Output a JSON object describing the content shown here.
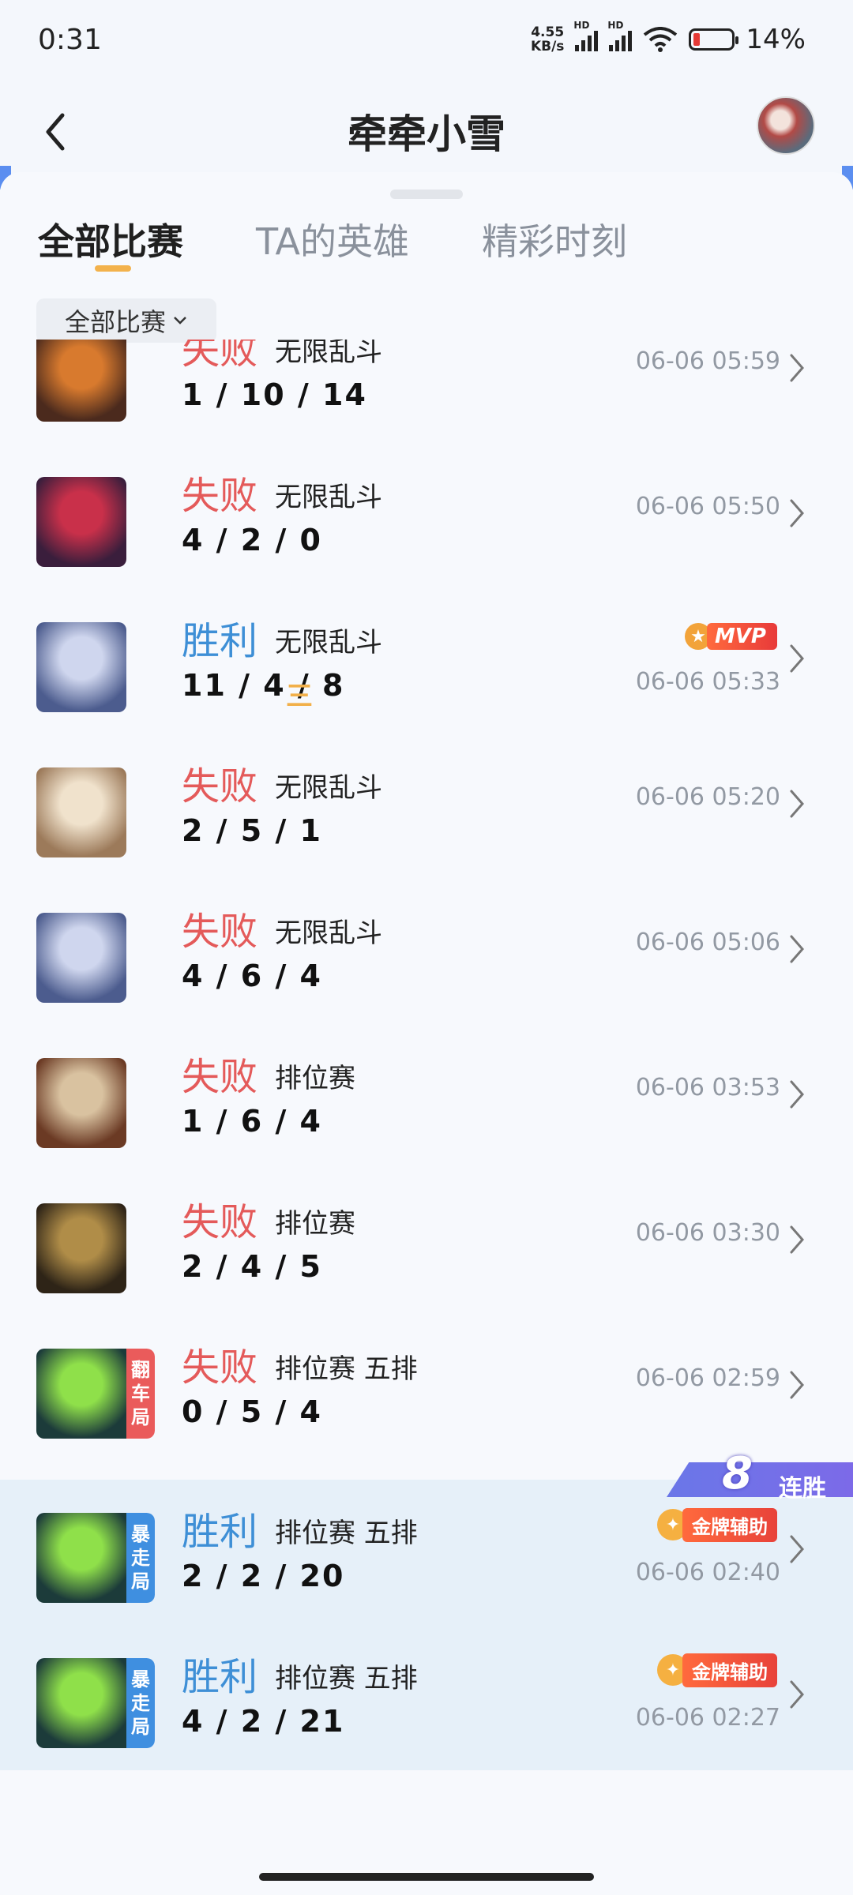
{
  "status_bar": {
    "time": "0:31",
    "speed_value": "4.55",
    "speed_unit": "KB/s",
    "hd1": "HD",
    "hd2": "HD",
    "battery": "14%"
  },
  "header": {
    "title": "牵牵小雪",
    "back_icon": "chevron-left-icon"
  },
  "tabs": [
    "全部比赛",
    "TA的英雄",
    "精彩时刻"
  ],
  "filter": {
    "label": "全部比赛",
    "icon": "chevron-down-icon"
  },
  "matches": [
    {
      "result": "失败",
      "outcome": "lose",
      "mode": "无限乱斗",
      "kda": "1 / 10 / 14",
      "time": "06-06 05:59",
      "hero_colors": [
        "#d87a2e",
        "#4b2a1d"
      ]
    },
    {
      "result": "失败",
      "outcome": "lose",
      "mode": "无限乱斗",
      "kda": "4 / 2 / 0",
      "time": "06-06 05:50",
      "hero_colors": [
        "#c9304a",
        "#3a1e3c"
      ]
    },
    {
      "result": "胜利",
      "outcome": "win",
      "mode": "无限乱斗",
      "kda": "11 / 4 / 8",
      "kda_icon": "三",
      "time": "06-06 05:33",
      "badge": "MVP",
      "hero_colors": [
        "#cfd6ee",
        "#4c5c8e"
      ]
    },
    {
      "result": "失败",
      "outcome": "lose",
      "mode": "无限乱斗",
      "kda": "2 / 5 / 1",
      "time": "06-06 05:20",
      "hero_colors": [
        "#f0e2cc",
        "#9c7a5a"
      ]
    },
    {
      "result": "失败",
      "outcome": "lose",
      "mode": "无限乱斗",
      "kda": "4 / 6 / 4",
      "time": "06-06 05:06",
      "hero_colors": [
        "#cfd6ee",
        "#4c5c8e"
      ]
    },
    {
      "result": "失败",
      "outcome": "lose",
      "mode": "排位赛",
      "kda": "1 / 6 / 4",
      "time": "06-06 03:53",
      "hero_colors": [
        "#d9c2a0",
        "#6b3a24"
      ]
    },
    {
      "result": "失败",
      "outcome": "lose",
      "mode": "排位赛",
      "kda": "2 / 4 / 5",
      "time": "06-06 03:30",
      "hero_colors": [
        "#b08d48",
        "#2e2417"
      ]
    },
    {
      "result": "失败",
      "outcome": "lose",
      "mode": "排位赛 五排",
      "kda": "0 / 5 / 4",
      "time": "06-06 02:59",
      "tag": "翻车局",
      "tag_color": "#ea5b5b",
      "hero_colors": [
        "#8fe04a",
        "#1c3b3a"
      ]
    },
    {
      "result": "胜利",
      "outcome": "win",
      "mode": "排位赛 五排",
      "kda": "2 / 2 / 20",
      "time": "06-06 02:40",
      "tag": "暴走局",
      "tag_color": "#3f8fe0",
      "badge": "金牌辅助",
      "hero_colors": [
        "#8fe04a",
        "#1c3b3a"
      ]
    },
    {
      "result": "胜利",
      "outcome": "win",
      "mode": "排位赛 五排",
      "kda": "4 / 2 / 21",
      "time": "06-06 02:27",
      "tag": "暴走局",
      "tag_color": "#3f8fe0",
      "badge": "金牌辅助",
      "hero_colors": [
        "#8fe04a",
        "#1c3b3a"
      ]
    }
  ],
  "streak": {
    "count": "8",
    "label": "连胜"
  },
  "colors": {
    "lose": "#e45a5a",
    "win": "#3e8fd6",
    "win_row_bg": "#e6f0f9",
    "tab_indicator": "#f3b24c"
  }
}
